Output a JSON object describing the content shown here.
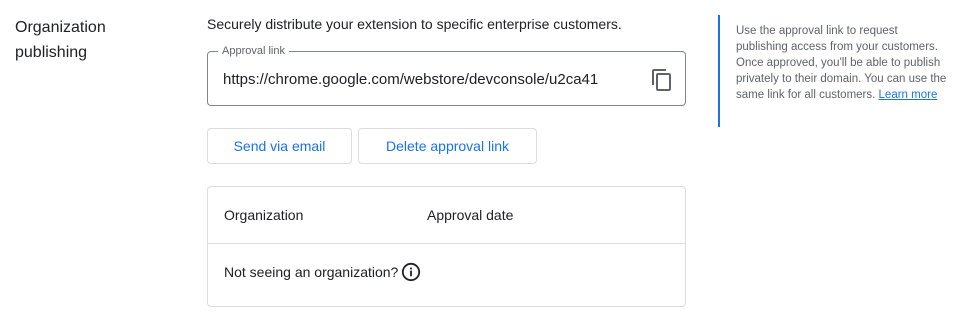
{
  "section": {
    "title": "Organization publishing"
  },
  "description": "Securely distribute your extension to specific enterprise customers.",
  "approval_link": {
    "label": "Approval link",
    "value": "https://chrome.google.com/webstore/devconsole/u2ca41",
    "copy_icon": "copy-icon"
  },
  "buttons": {
    "send_email": "Send via email",
    "delete_link": "Delete approval link"
  },
  "table": {
    "columns": [
      "Organization",
      "Approval date"
    ],
    "empty_text": "Not seeing an organization?",
    "info_icon": "info-icon"
  },
  "help": {
    "text": "Use the approval link to request publishing access from your customers. Once approved, you'll be able to publish privately to their domain. You can use the same link for all customers.",
    "link_text": "Learn more"
  },
  "colors": {
    "accent": "#1a73e8",
    "border": "#dadce0",
    "text": "#202124",
    "secondary_text": "#5f6368"
  }
}
